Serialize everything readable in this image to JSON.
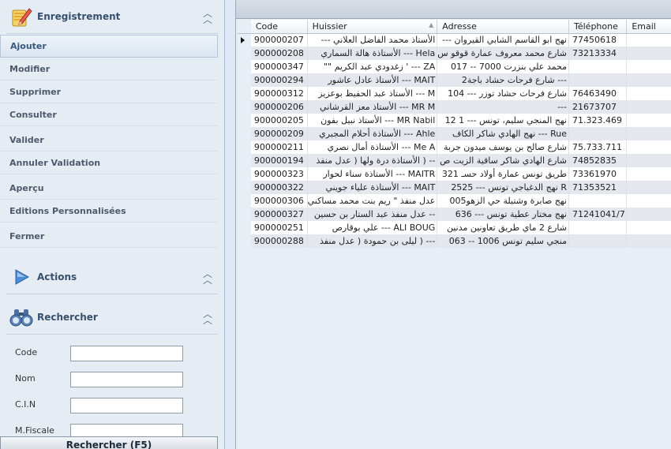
{
  "sidebar": {
    "enregistrement": {
      "title": "Enregistrement",
      "items": [
        {
          "label": "Ajouter"
        },
        {
          "label": "Modifier"
        },
        {
          "label": "Supprimer"
        },
        {
          "label": "Consulter"
        },
        {
          "label": "Valider"
        },
        {
          "label": "Annuler Validation"
        },
        {
          "label": "Aperçu"
        },
        {
          "label": "Editions Personnalisées"
        },
        {
          "label": "Fermer"
        }
      ]
    },
    "actions": {
      "title": "Actions"
    },
    "rechercher": {
      "title": "Rechercher",
      "fields": [
        {
          "label": "Code",
          "value": ""
        },
        {
          "label": "Nom",
          "value": ""
        },
        {
          "label": "C.I.N",
          "value": ""
        },
        {
          "label": "M.Fiscale",
          "value": ""
        }
      ],
      "button_label": "Rechercher (F5)"
    }
  },
  "grid": {
    "columns": [
      "Code",
      "Huissier",
      "Adresse",
      "Téléphone",
      "Email"
    ],
    "sorted_column": "Huissier",
    "rows": [
      [
        "900000207",
        "الأستاذ محمد الفاضل العلاني ---",
        "نهج ابو القاسم الشابي القيروان ---",
        "77450618",
        ""
      ],
      [
        "900000208",
        "Hela --- الأستاذة هالة السماري",
        "شارع محمد معروف عمارة قوقو س",
        "73213334",
        ""
      ],
      [
        "900000347",
        "ZA --- ' زغدودي عبد الكريم \"\"",
        "محمد علي بنزرت 7000 -- 017",
        "",
        ""
      ],
      [
        "900000294",
        "MAIT --- الأستاذ عادل عاشور",
        "--- شارع فرحات حشاد باجة2",
        "",
        ""
      ],
      [
        "900000312",
        "M --- الأستاذ عبد الحفيظ بوعزيز",
        "شارع فرحات حشاد توزر --- 104",
        "76463490",
        ""
      ],
      [
        "900000206",
        "MR M --- الأستاذ معز القرشاني",
        "---",
        "21673707",
        ""
      ],
      [
        "900000205",
        "MR Nabil --- الأستاذ نبيل بفون",
        "نهج المنجي سليم، تونس --- 1 12",
        "71.323.469",
        ""
      ],
      [
        "900000209",
        "Ahle --- الأستاذة أحلام المجبري",
        "Rue --- نهج الهادي شاكر الكاف",
        "",
        ""
      ],
      [
        "900000211",
        "Me A --- الأستاذة أمال نصري",
        "شارع صالح بن يوسف ميدون جربة",
        "75.733.711",
        ""
      ],
      [
        "900000194",
        "-- ( الأستاذة درة ولها ( عدل منفذ",
        "شارع الهادي شاكر ساقية الزيت ص",
        "74852835",
        ""
      ],
      [
        "900000323",
        "MAITR --- الأستاذة سناء لحوار",
        "طريق تونس عمارة أولاد حسـ 321",
        "73361970",
        ""
      ],
      [
        "900000322",
        "MAIT --- الأستاذة علياء جويني",
        "R نهج الدغباجي تونس --- 2525",
        "71353521",
        ""
      ],
      [
        "900000306",
        "عدل منفذ \" ريم بنت محمد مساكني",
        "نهج صابرة وشتيلة حي الزهو005",
        "",
        ""
      ],
      [
        "900000327",
        "-- عدل منفذ عبد الستار بن حسين",
        "نهج مختار عطية تونس --- 636",
        "71241041/7",
        ""
      ],
      [
        "900000251",
        "ALI BOUG --- علي بوقارص",
        "شارع 2 ماي طريق تعاونين مدنين",
        "",
        ""
      ],
      [
        "900000288",
        "--- ( ليلى بن حمودة ( عدل منفذ",
        "منجي سليم تونس 1006 -- 063",
        "",
        ""
      ]
    ]
  }
}
